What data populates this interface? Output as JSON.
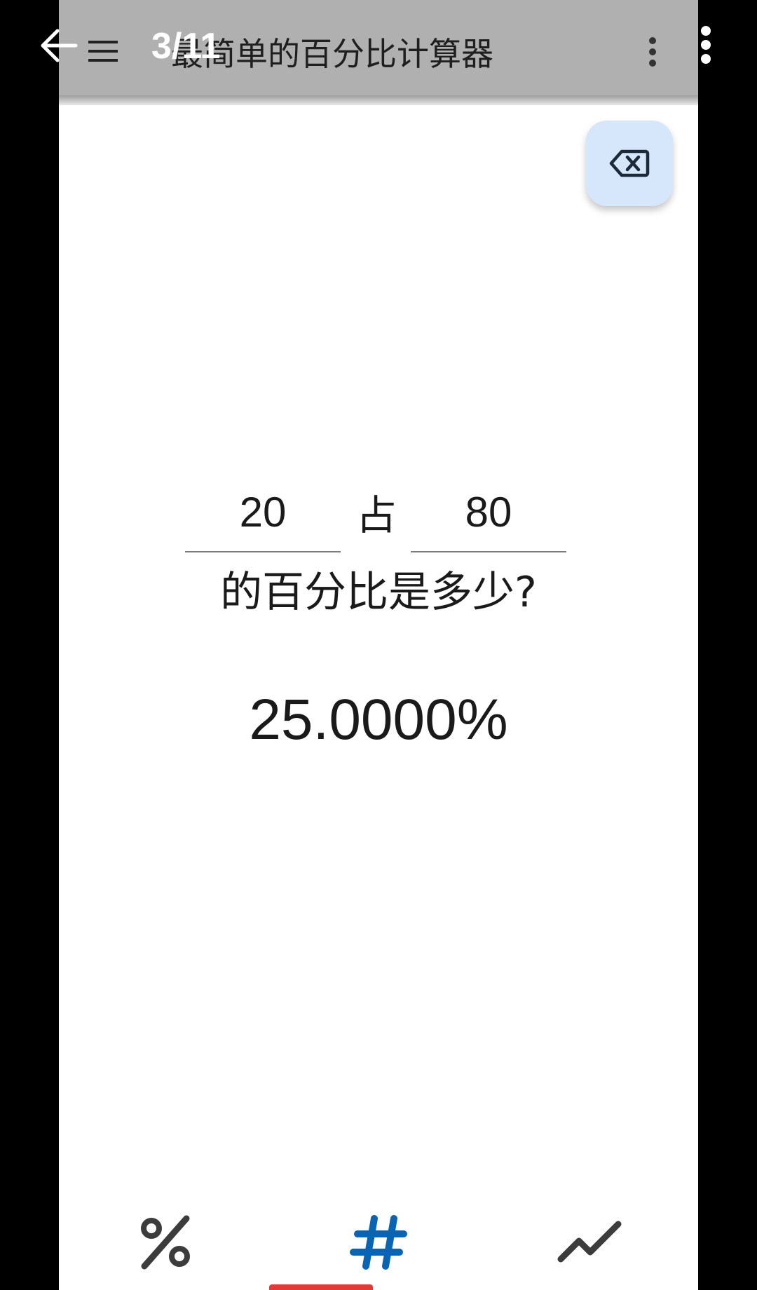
{
  "viewer": {
    "counter": "3/11",
    "icon_back": "arrow-back-icon",
    "icon_more": "more-vert-icon",
    "text_color": "#ffffff"
  },
  "appbar": {
    "title": "最简单的百分比计算器",
    "icon_menu": "hamburger-menu-icon",
    "icon_more": "more-vert-icon",
    "background": "#b0b0b0"
  },
  "fab": {
    "icon": "backspace-icon",
    "background": "#d6e6fb"
  },
  "calculator": {
    "value_a": "20",
    "of_label": "占",
    "value_b": "80",
    "question": "的百分比是多少?",
    "result": "25.0000%"
  },
  "bottom_nav": {
    "items": [
      {
        "icon": "percent-icon",
        "selected": false
      },
      {
        "icon": "number-sign-icon",
        "selected": true
      },
      {
        "icon": "trending-icon",
        "selected": false
      }
    ],
    "accent": "#0a64b4",
    "indicator_color": "#e53935",
    "inactive_color": "#3c3c3c"
  }
}
